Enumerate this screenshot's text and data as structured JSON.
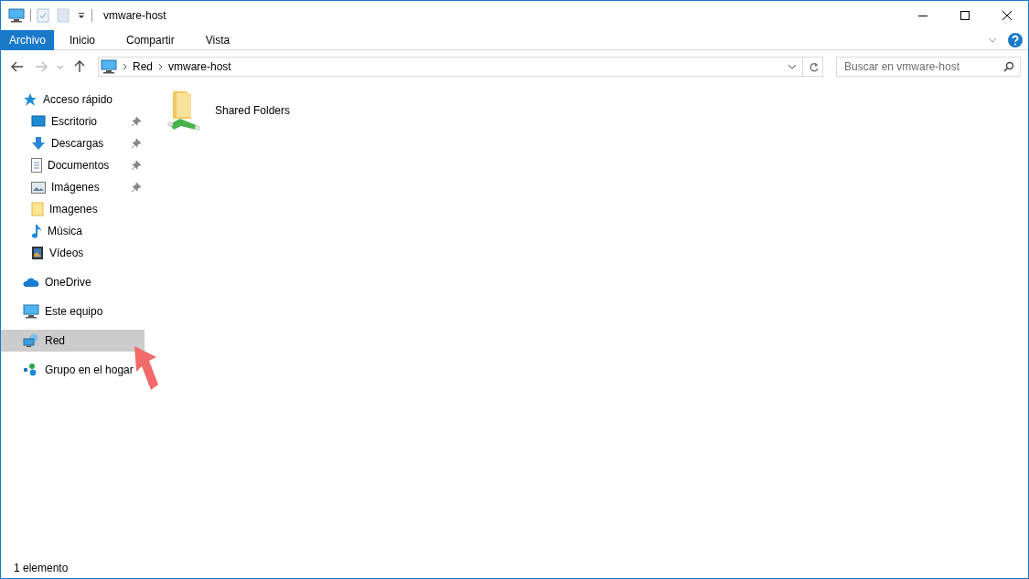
{
  "window": {
    "title": "vmware-host"
  },
  "ribbon_tabs": [
    {
      "label": "Archivo",
      "selected": true
    },
    {
      "label": "Inicio",
      "selected": false
    },
    {
      "label": "Compartir",
      "selected": false
    },
    {
      "label": "Vista",
      "selected": false
    }
  ],
  "address_bar": {
    "path": [
      "Red",
      "vmware-host"
    ]
  },
  "search": {
    "placeholder": "Buscar en vmware-host"
  },
  "sidebar": {
    "groups": [
      {
        "label": "Acceso rápido",
        "kind": "star",
        "selected": false,
        "children": [
          {
            "label": "Escritorio",
            "kind": "desktop",
            "pinned": true,
            "selected": false
          },
          {
            "label": "Descargas",
            "kind": "download",
            "pinned": true,
            "selected": false
          },
          {
            "label": "Documentos",
            "kind": "document",
            "pinned": true,
            "selected": false
          },
          {
            "label": "Imágenes",
            "kind": "image",
            "pinned": true,
            "selected": false
          },
          {
            "label": "Imagenes",
            "kind": "folder",
            "pinned": false,
            "selected": false
          },
          {
            "label": "Música",
            "kind": "music",
            "pinned": false,
            "selected": false
          },
          {
            "label": "Vídeos",
            "kind": "film",
            "pinned": false,
            "selected": false
          }
        ]
      },
      {
        "label": "OneDrive",
        "kind": "cloud",
        "selected": false
      },
      {
        "label": "Este equipo",
        "kind": "computer",
        "selected": false
      },
      {
        "label": "Red",
        "kind": "network",
        "selected": true
      },
      {
        "label": "Grupo en el hogar",
        "kind": "homegroup",
        "selected": false
      }
    ]
  },
  "content": {
    "items": [
      {
        "label": "Shared Folders"
      }
    ]
  },
  "status_bar": {
    "count": "1 elemento"
  }
}
